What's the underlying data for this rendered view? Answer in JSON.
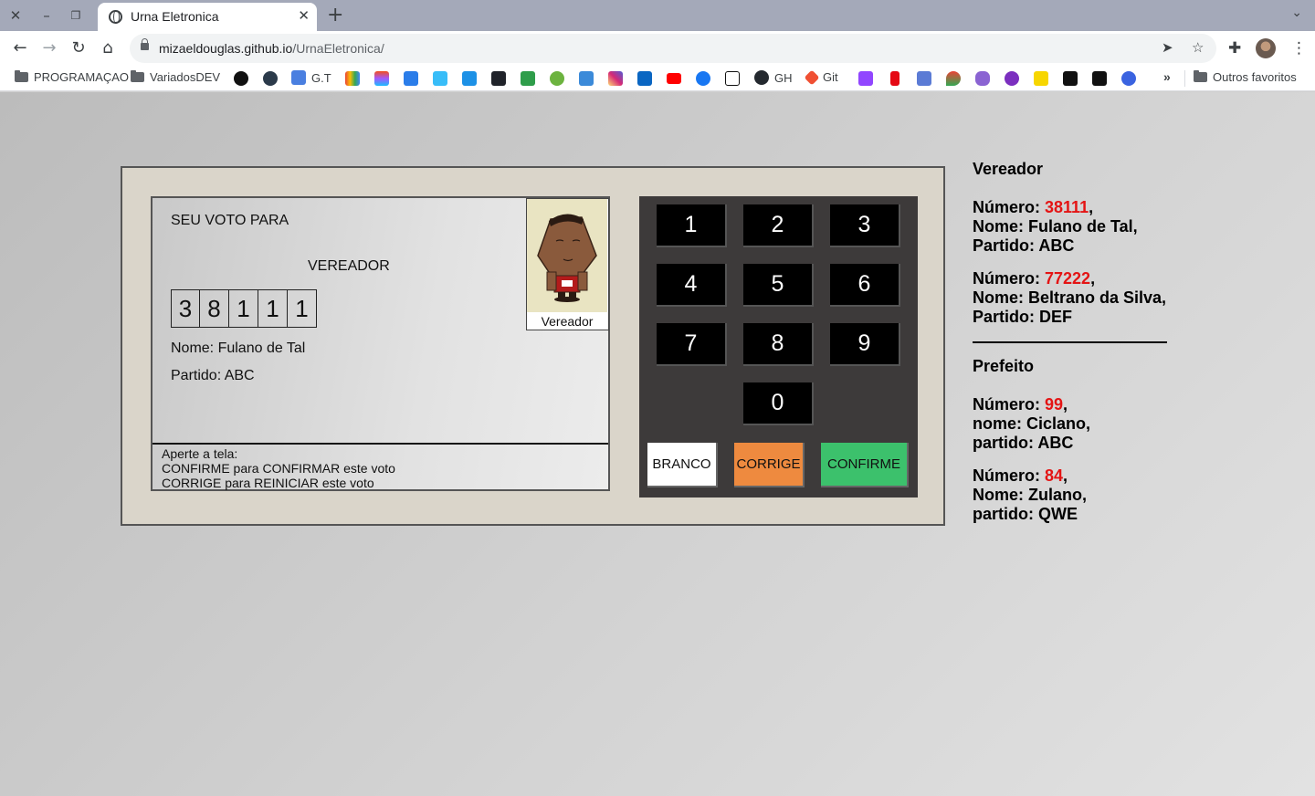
{
  "browser": {
    "tab_title": "Urna Eletronica",
    "url_host": "mizaeldouglas.github.io",
    "url_path": "/UrnaEletronica/",
    "bookmarks": [
      {
        "label": "PROGRAMAÇAO",
        "icon": "folder-icon"
      },
      {
        "label": "VariadosDEV",
        "icon": "folder-icon"
      },
      {
        "label": "G.T",
        "icon": "google-translate-icon"
      },
      {
        "label": "GH",
        "icon": "github-icon"
      },
      {
        "label": "Git",
        "icon": "git-icon"
      }
    ],
    "other_bookmarks": "Outros favoritos",
    "more_bookmarks": "»"
  },
  "tela": {
    "seu_voto": "SEU VOTO PARA",
    "cargo": "VEREADOR",
    "digitos": [
      "3",
      "8",
      "1",
      "1",
      "1"
    ],
    "nome": "Nome: Fulano de Tal",
    "partido": "Partido: ABC",
    "foto_label": "Vereador",
    "aviso": [
      "Aperte a tela:",
      "CONFIRME para CONFIRMAR este voto",
      "CORRIGE para REINICIAR este voto"
    ]
  },
  "teclado": {
    "teclas": [
      "1",
      "2",
      "3",
      "4",
      "5",
      "6",
      "7",
      "8",
      "9",
      "0"
    ],
    "branco": "BRANCO",
    "corrige": "CORRIGE",
    "confirme": "CONFIRME"
  },
  "lateral": {
    "vereador_title": "Vereador",
    "vereadores": [
      {
        "numero_label": "Número: ",
        "numero": "38111",
        "nome": "Nome: Fulano de Tal,",
        "partido": "Partido: ABC"
      },
      {
        "numero_label": "Número: ",
        "numero": "77222",
        "nome": "Nome: Beltrano da Silva,",
        "partido": "Partido: DEF"
      }
    ],
    "prefeito_title": "Prefeito",
    "prefeitos": [
      {
        "numero_label": "Número: ",
        "numero": "99",
        "nome": "nome: Ciclano,",
        "partido": "partido: ABC"
      },
      {
        "numero_label": "Número: ",
        "numero": "84",
        "nome": "Nome: Zulano,",
        "partido": "partido: QWE"
      }
    ]
  },
  "colors": {
    "numero_red": "#e41414",
    "corrige": "#ee8a3f",
    "confirme": "#3cc16c",
    "urna_bg": "#dad5ca",
    "teclado_bg": "#3d3a3a"
  }
}
